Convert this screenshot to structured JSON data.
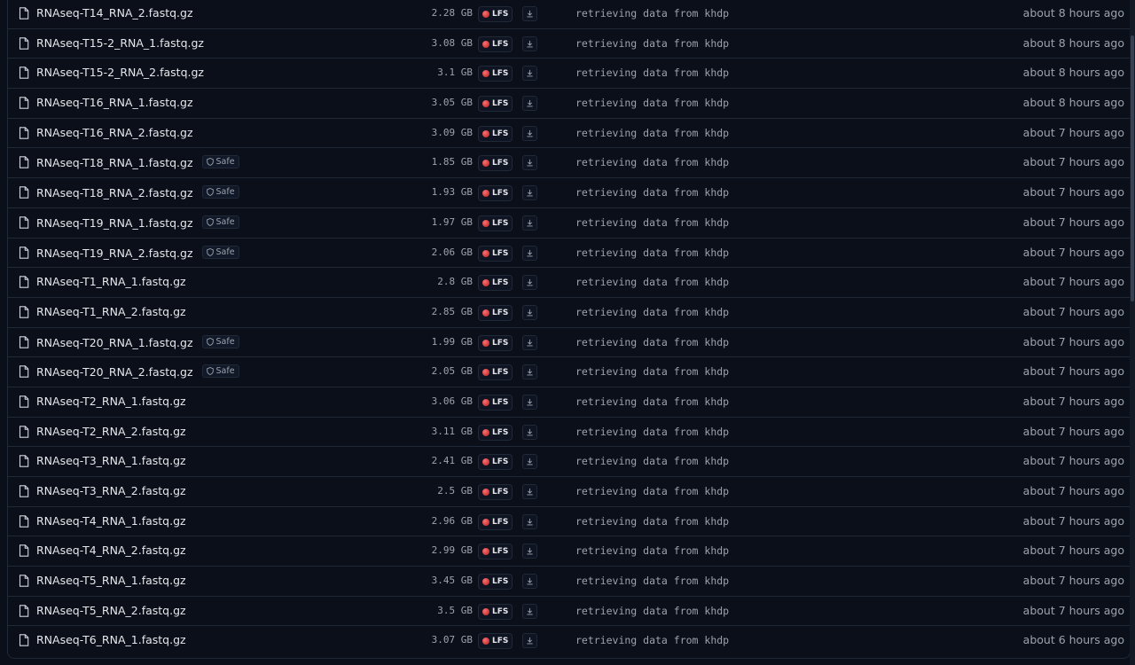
{
  "lfs_label": "LFS",
  "safe_label": "Safe",
  "commit_message": "retrieving data from khdp",
  "files": [
    {
      "name": "RNAseq-T14_RNA_2.fastq.gz",
      "size": "2.28 GB",
      "safe": false,
      "time": "about 8 hours ago"
    },
    {
      "name": "RNAseq-T15-2_RNA_1.fastq.gz",
      "size": "3.08 GB",
      "safe": false,
      "time": "about 8 hours ago"
    },
    {
      "name": "RNAseq-T15-2_RNA_2.fastq.gz",
      "size": "3.1 GB",
      "safe": false,
      "time": "about 8 hours ago"
    },
    {
      "name": "RNAseq-T16_RNA_1.fastq.gz",
      "size": "3.05 GB",
      "safe": false,
      "time": "about 8 hours ago"
    },
    {
      "name": "RNAseq-T16_RNA_2.fastq.gz",
      "size": "3.09 GB",
      "safe": false,
      "time": "about 7 hours ago"
    },
    {
      "name": "RNAseq-T18_RNA_1.fastq.gz",
      "size": "1.85 GB",
      "safe": true,
      "time": "about 7 hours ago"
    },
    {
      "name": "RNAseq-T18_RNA_2.fastq.gz",
      "size": "1.93 GB",
      "safe": true,
      "time": "about 7 hours ago"
    },
    {
      "name": "RNAseq-T19_RNA_1.fastq.gz",
      "size": "1.97 GB",
      "safe": true,
      "time": "about 7 hours ago"
    },
    {
      "name": "RNAseq-T19_RNA_2.fastq.gz",
      "size": "2.06 GB",
      "safe": true,
      "time": "about 7 hours ago"
    },
    {
      "name": "RNAseq-T1_RNA_1.fastq.gz",
      "size": "2.8 GB",
      "safe": false,
      "time": "about 7 hours ago"
    },
    {
      "name": "RNAseq-T1_RNA_2.fastq.gz",
      "size": "2.85 GB",
      "safe": false,
      "time": "about 7 hours ago"
    },
    {
      "name": "RNAseq-T20_RNA_1.fastq.gz",
      "size": "1.99 GB",
      "safe": true,
      "time": "about 7 hours ago"
    },
    {
      "name": "RNAseq-T20_RNA_2.fastq.gz",
      "size": "2.05 GB",
      "safe": true,
      "time": "about 7 hours ago"
    },
    {
      "name": "RNAseq-T2_RNA_1.fastq.gz",
      "size": "3.06 GB",
      "safe": false,
      "time": "about 7 hours ago"
    },
    {
      "name": "RNAseq-T2_RNA_2.fastq.gz",
      "size": "3.11 GB",
      "safe": false,
      "time": "about 7 hours ago"
    },
    {
      "name": "RNAseq-T3_RNA_1.fastq.gz",
      "size": "2.41 GB",
      "safe": false,
      "time": "about 7 hours ago"
    },
    {
      "name": "RNAseq-T3_RNA_2.fastq.gz",
      "size": "2.5 GB",
      "safe": false,
      "time": "about 7 hours ago"
    },
    {
      "name": "RNAseq-T4_RNA_1.fastq.gz",
      "size": "2.96 GB",
      "safe": false,
      "time": "about 7 hours ago"
    },
    {
      "name": "RNAseq-T4_RNA_2.fastq.gz",
      "size": "2.99 GB",
      "safe": false,
      "time": "about 7 hours ago"
    },
    {
      "name": "RNAseq-T5_RNA_1.fastq.gz",
      "size": "3.45 GB",
      "safe": false,
      "time": "about 7 hours ago"
    },
    {
      "name": "RNAseq-T5_RNA_2.fastq.gz",
      "size": "3.5 GB",
      "safe": false,
      "time": "about 7 hours ago"
    },
    {
      "name": "RNAseq-T6_RNA_1.fastq.gz",
      "size": "3.07 GB",
      "safe": false,
      "time": "about 6 hours ago"
    }
  ]
}
